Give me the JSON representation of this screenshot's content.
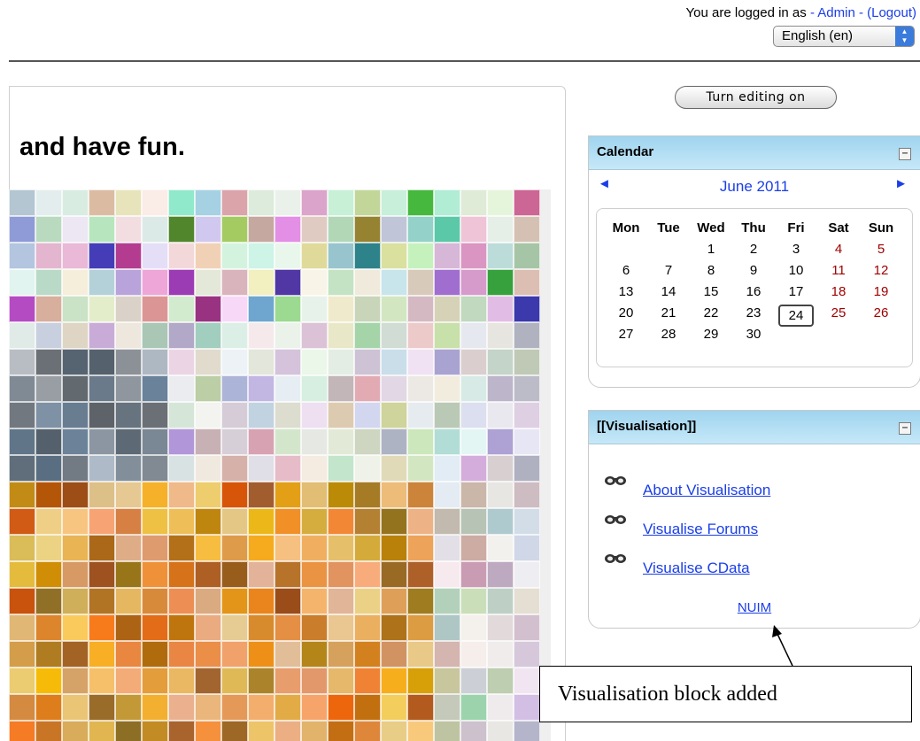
{
  "header": {
    "logged_in_prefix": "You are logged in as ",
    "user_link": "- Admin -",
    "logout_link": "(Logout)",
    "language": "English (en)"
  },
  "main": {
    "headline": "and have fun."
  },
  "sidebar": {
    "edit_button": "Turn editing on",
    "calendar": {
      "title": "Calendar",
      "hide_icon": "minus-box-icon",
      "month": "June 2011",
      "prev_icon": "◄",
      "next_icon": "►",
      "weekdays": [
        "Mon",
        "Tue",
        "Wed",
        "Thu",
        "Fri",
        "Sat",
        "Sun"
      ],
      "days": [
        [
          "",
          "",
          "1",
          "2",
          "3",
          "4",
          "5"
        ],
        [
          "6",
          "7",
          "8",
          "9",
          "10",
          "11",
          "12"
        ],
        [
          "13",
          "14",
          "15",
          "16",
          "17",
          "18",
          "19"
        ],
        [
          "20",
          "21",
          "22",
          "23",
          "24",
          "25",
          "26"
        ],
        [
          "27",
          "28",
          "29",
          "30",
          "",
          "",
          ""
        ]
      ],
      "today": "24",
      "weekend_color": "#a00000"
    },
    "visualisation": {
      "title": "[[Visualisation]]",
      "links": [
        "About Visualisation",
        "Visualise Forums",
        "Visualise CData"
      ],
      "link_icon": "glasses-icon",
      "footer": "NUIM"
    }
  },
  "annotation": {
    "text": "Visualisation block added"
  },
  "colors": {
    "link": "#1a3ee8",
    "block_header": "#b3def4"
  }
}
